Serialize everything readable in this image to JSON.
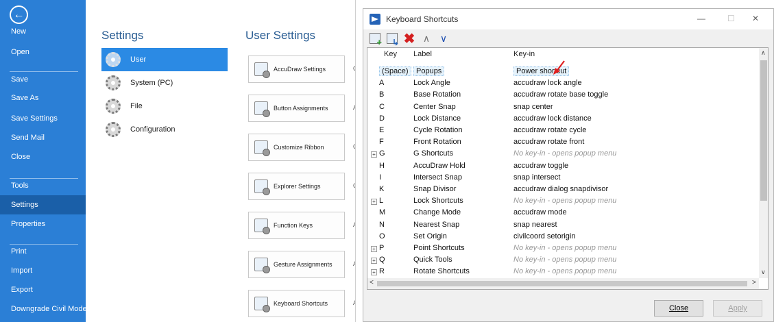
{
  "backstage": {
    "back_label": "←",
    "nav_items": [
      "New",
      "Open",
      "Save",
      "Save As",
      "Save Settings",
      "Send Mail",
      "Close",
      "Tools",
      "Settings",
      "Properties",
      "Print",
      "Import",
      "Export",
      "Downgrade Civil Model"
    ],
    "selected_nav": "Settings",
    "settings_title": "Settings",
    "user_settings_title": "User Settings",
    "categories": [
      "User",
      "System (PC)",
      "File",
      "Configuration"
    ],
    "selected_category": "User",
    "setting_buttons": [
      "AccuDraw Settings",
      "Button Assignments",
      "Customize Ribbon",
      "Explorer Settings",
      "Function Keys",
      "Gesture Assignments",
      "Keyboard Shortcuts"
    ],
    "side_letters": [
      "C",
      "A",
      "C",
      "C",
      "A",
      "A",
      "A"
    ]
  },
  "dialog": {
    "title": "Keyboard Shortcuts",
    "columns": {
      "key": "Key",
      "label": "Label",
      "keyin": "Key-in"
    },
    "rows": [
      {
        "expand": "",
        "key": "(Space)",
        "label": "Popups",
        "keyin": "Power shortcut",
        "italic": false,
        "selected": true
      },
      {
        "expand": "",
        "key": "A",
        "label": "Lock Angle",
        "keyin": "accudraw lock angle",
        "italic": false
      },
      {
        "expand": "",
        "key": "B",
        "label": "Base Rotation",
        "keyin": "accudraw rotate base toggle",
        "italic": false
      },
      {
        "expand": "",
        "key": "C",
        "label": "Center Snap",
        "keyin": "snap center",
        "italic": false
      },
      {
        "expand": "",
        "key": "D",
        "label": "Lock Distance",
        "keyin": "accudraw lock distance",
        "italic": false
      },
      {
        "expand": "",
        "key": "E",
        "label": "Cycle Rotation",
        "keyin": "accudraw rotate cycle",
        "italic": false
      },
      {
        "expand": "",
        "key": "F",
        "label": "Front Rotation",
        "keyin": "accudraw rotate front",
        "italic": false
      },
      {
        "expand": "+",
        "key": "G",
        "label": "G Shortcuts",
        "keyin": "No key-in - opens popup menu",
        "italic": true
      },
      {
        "expand": "",
        "key": "H",
        "label": "AccuDraw Hold",
        "keyin": "accudraw toggle",
        "italic": false
      },
      {
        "expand": "",
        "key": "I",
        "label": "Intersect Snap",
        "keyin": "snap intersect",
        "italic": false
      },
      {
        "expand": "",
        "key": "K",
        "label": "Snap Divisor",
        "keyin": "accudraw dialog snapdivisor",
        "italic": false
      },
      {
        "expand": "+",
        "key": "L",
        "label": "Lock Shortcuts",
        "keyin": "No key-in - opens popup menu",
        "italic": true
      },
      {
        "expand": "",
        "key": "M",
        "label": "Change Mode",
        "keyin": "accudraw mode",
        "italic": false
      },
      {
        "expand": "",
        "key": "N",
        "label": "Nearest Snap",
        "keyin": "snap nearest",
        "italic": false
      },
      {
        "expand": "",
        "key": "O",
        "label": "Set Origin",
        "keyin": "civilcoord setorigin",
        "italic": false
      },
      {
        "expand": "+",
        "key": "P",
        "label": "Point Shortcuts",
        "keyin": "No key-in - opens popup menu",
        "italic": true
      },
      {
        "expand": "+",
        "key": "Q",
        "label": "Quick Tools",
        "keyin": "No key-in - opens popup menu",
        "italic": true
      },
      {
        "expand": "+",
        "key": "R",
        "label": "Rotate Shortcuts",
        "keyin": "No key-in - opens popup menu",
        "italic": true
      }
    ],
    "close_label": "Close",
    "apply_label": "Apply",
    "minimize_label": "—",
    "maximize_label": "☐",
    "close_window_label": "✕",
    "delete_label": "✖",
    "up_label": "∧",
    "down_label": "∨",
    "scroll_up": "∧",
    "scroll_down": "∨",
    "scroll_left": "<",
    "scroll_right": ">"
  },
  "colors": {
    "nav_bg": "#2b7fd6",
    "nav_selected": "#1a5fa8",
    "accent": "#2b8ae4",
    "delete_red": "#d42020",
    "annotation_arrow": "#e02020"
  },
  "icons": [
    "back-arrow-icon",
    "gear-icon",
    "accudraw-icon",
    "button-assignments-icon",
    "ribbon-icon",
    "explorer-icon",
    "function-keys-icon",
    "gesture-icon",
    "keyboard-icon",
    "new-item-icon",
    "new-submenu-icon",
    "delete-icon",
    "move-up-icon",
    "move-down-icon",
    "red-annotation-arrow-icon"
  ]
}
